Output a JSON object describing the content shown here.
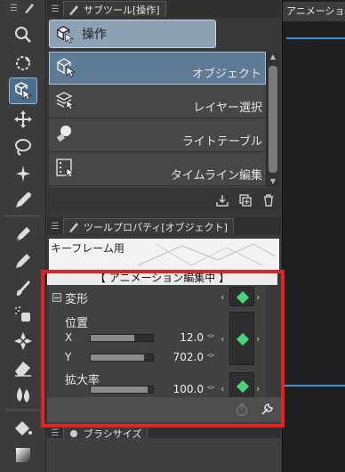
{
  "subtool": {
    "tab_label": "サブツール[操作]",
    "group_label": "操作",
    "items": [
      "オブジェクト",
      "レイヤー選択",
      "ライトテーブル",
      "タイムライン編集"
    ]
  },
  "property": {
    "tab_label": "ツールプロパティ[オブジェクト]",
    "keyframe_label": "キーフレーム用",
    "anim_label": "【 アニメーション編集中 】",
    "transform_label": "変形",
    "position_label": "位置",
    "x_label": "X",
    "x_value": "12.0",
    "x_slider_fraction": 0.7,
    "y_label": "Y",
    "y_value": "702.0",
    "y_slider_fraction": 0.85,
    "scale_label": "拡大率",
    "scale_value": "100.0",
    "scale_slider_fraction": 0.92
  },
  "brush": {
    "tab_label": "ブラシサイズ"
  },
  "right": {
    "tab_label": "アニメーション"
  },
  "colors": {
    "keyframe": "#4bd17a",
    "highlight": "#e02424",
    "selection": "#5e7a95",
    "timeline": "#3d8fd6"
  }
}
